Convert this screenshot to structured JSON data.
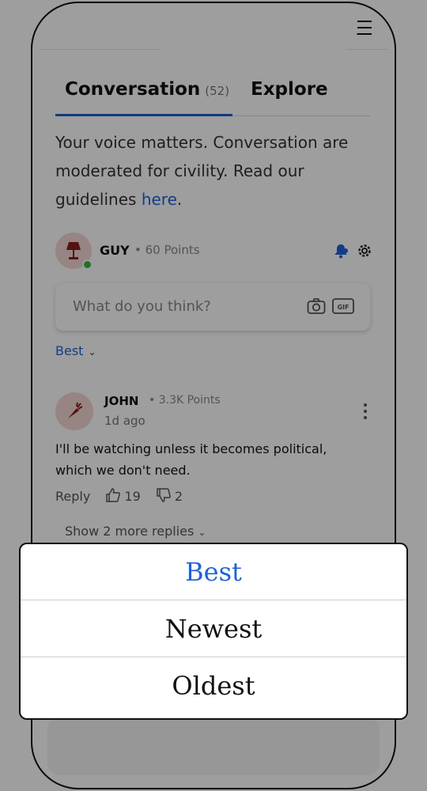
{
  "tabs": {
    "conversation_label": "Conversation",
    "conversation_count": "(52)",
    "explore_label": "Explore"
  },
  "intro": {
    "text": "Your voice matters. Conversation are moderated for civility. Read our guidelines ",
    "link_text": "here",
    "end": "."
  },
  "current_user": {
    "name": "GUY",
    "points": "• 60 Points"
  },
  "comment_input": {
    "placeholder": "What do you think?"
  },
  "sort": {
    "selected": "Best"
  },
  "comment": {
    "author": "JOHN",
    "points": "• 3.3K Points",
    "time": "1d ago",
    "text": "I'll be watching unless it becomes political, which we don't need.",
    "reply_label": "Reply",
    "likes": "19",
    "dislikes": "2",
    "more_replies": "Show 2 more replies"
  },
  "sort_sheet": {
    "options": [
      "Best",
      "Newest",
      "Oldest"
    ],
    "selected": "Best"
  },
  "colors": {
    "accent": "#1f62d8",
    "tab_underline": "#1b5fd1",
    "online": "#3bb54a"
  }
}
